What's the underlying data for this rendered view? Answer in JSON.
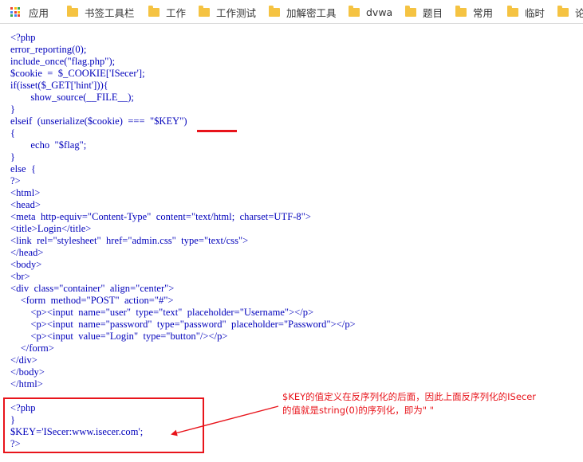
{
  "bookmarks_bar": {
    "apps_label": "应用",
    "folders": [
      "书签工具栏",
      "工作",
      "工作测试",
      "加解密工具",
      "dvwa",
      "题目",
      "常用",
      "临时",
      "论"
    ]
  },
  "code_lines": [
    "<?php",
    "error_reporting(0);",
    "include_once(\"flag.php\");",
    "$cookie  =  $_COOKIE['ISecer'];",
    "if(isset($_GET['hint'])){",
    "        show_source(__FILE__);",
    "}",
    "elseif  (unserialize($cookie)  ===  \"$KEY\")",
    "{",
    "        echo  \"$flag\";",
    "}",
    "else  {",
    "?>",
    "<html>",
    "<head>",
    "<meta  http-equiv=\"Content-Type\"  content=\"text/html;  charset=UTF-8\">",
    "<title>Login</title>",
    "<link  rel=\"stylesheet\"  href=\"admin.css\"  type=\"text/css\">",
    "</head>",
    "<body>",
    "<br>",
    "<div  class=\"container\"  align=\"center\">",
    "    <form  method=\"POST\"  action=\"#\">",
    "        <p><input  name=\"user\"  type=\"text\"  placeholder=\"Username\"></p>",
    "        <p><input  name=\"password\"  type=\"password\"  placeholder=\"Password\"></p>",
    "        <p><input  value=\"Login\"  type=\"button\"/></p>",
    "    </form>",
    "</div>",
    "</body>",
    "</html>",
    "",
    "<?php",
    "}",
    "$KEY='ISecer:www.isecer.com';",
    "?>"
  ],
  "annotation": {
    "line1": "$KEY的值定义在反序列化的后面，因此上面反序列化的ISecer",
    "line2": "的值就是string(0)的序列化，即为\" \""
  },
  "colors": {
    "code_text": "#0000bb",
    "highlight_red": "#e8141b",
    "folder_yellow": "#f5c342"
  }
}
